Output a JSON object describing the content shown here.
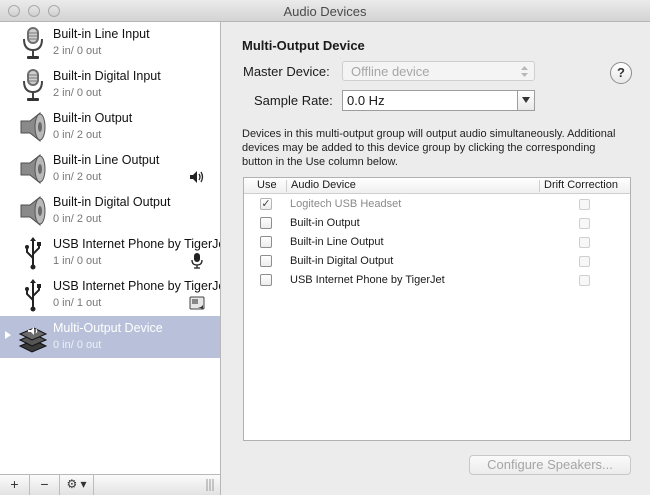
{
  "window": {
    "title": "Audio Devices"
  },
  "sidebar": {
    "devices": [
      {
        "name": "Built-in Line Input",
        "io": "2 in/ 0 out",
        "icon": "microphone-icon",
        "badge": ""
      },
      {
        "name": "Built-in Digital Input",
        "io": "2 in/ 0 out",
        "icon": "microphone-icon",
        "badge": ""
      },
      {
        "name": "Built-in Output",
        "io": "0 in/ 2 out",
        "icon": "speaker-icon",
        "badge": ""
      },
      {
        "name": "Built-in Line Output",
        "io": "0 in/ 2 out",
        "icon": "speaker-icon",
        "badge": "speaker-volume-icon"
      },
      {
        "name": "Built-in Digital Output",
        "io": "0 in/ 2 out",
        "icon": "speaker-icon",
        "badge": ""
      },
      {
        "name": "USB Internet Phone by TigerJet",
        "io": "1 in/ 0 out",
        "icon": "usb-icon",
        "badge": "microphone-badge-icon"
      },
      {
        "name": "USB Internet Phone by TigerJet",
        "io": "0 in/ 1 out",
        "icon": "usb-icon",
        "badge": "system-output-badge-icon"
      },
      {
        "name": "Multi-Output Device",
        "io": "0 in/ 0 out",
        "icon": "multi-output-icon",
        "badge": "",
        "selected": true
      }
    ],
    "toolbar": {
      "add_label": "+",
      "remove_label": "−",
      "gear_label": "⚙ ▾"
    }
  },
  "detail": {
    "title": "Multi-Output Device",
    "master_label": "Master Device:",
    "master_value": "Offline device",
    "rate_label": "Sample Rate:",
    "rate_value": "0.0 Hz",
    "help_label": "?",
    "description": "Devices in this multi-output group will output audio simultaneously. Additional devices may be added to this device group by clicking the corresponding button in the Use column below.",
    "table": {
      "headers": {
        "use": "Use",
        "device": "Audio Device",
        "drift": "Drift Correction"
      },
      "rows": [
        {
          "use": true,
          "device": "Logitech USB Headset",
          "dimmed": true,
          "drift": false
        },
        {
          "use": false,
          "device": "Built-in Output",
          "dimmed": false,
          "drift": false
        },
        {
          "use": false,
          "device": "Built-in Line Output",
          "dimmed": false,
          "drift": false
        },
        {
          "use": false,
          "device": "Built-in Digital Output",
          "dimmed": false,
          "drift": false
        },
        {
          "use": false,
          "device": "USB Internet Phone by TigerJet",
          "dimmed": false,
          "drift": false
        }
      ]
    },
    "configure_label": "Configure Speakers...",
    "check_glyph": "✓"
  }
}
